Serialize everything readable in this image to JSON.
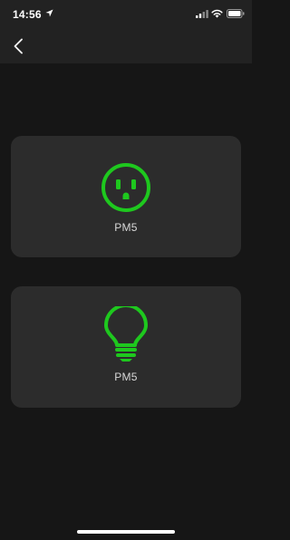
{
  "status_bar": {
    "time": "14:56",
    "icons": [
      "location-arrow-icon",
      "cellular-signal-icon",
      "wifi-icon",
      "battery-icon"
    ]
  },
  "nav": {
    "back_icon": "chevron-left-icon"
  },
  "devices": [
    {
      "label": "PM5",
      "icon": "power-outlet-icon"
    },
    {
      "label": "PM5",
      "icon": "light-bulb-icon"
    }
  ],
  "colors": {
    "accent": "#1ec81e",
    "background": "#161616",
    "bar": "#222222",
    "card": "#2c2c2c"
  }
}
